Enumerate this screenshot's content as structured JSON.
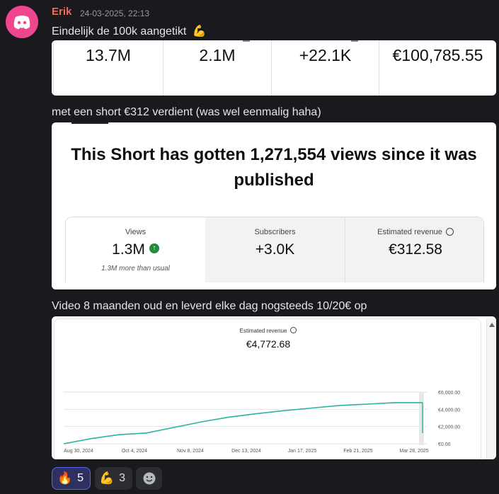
{
  "message": {
    "author": "Erik",
    "timestamp": "24-03-2025, 22:13",
    "line1": "Eindelijk de 100k aangetikt",
    "line2": "met een short €312 verdient (was wel eenmalig haha)",
    "line3": "Video 8 maanden oud en leverd elke dag nogsteeds 10/20€ op"
  },
  "metrics_strip": {
    "values": [
      "13.7M",
      "2.1M",
      "+22.1K",
      "€100,785.55"
    ]
  },
  "short_card": {
    "headline": "This Short has gotten 1,271,554 views since it was published",
    "stats": [
      {
        "label": "Views",
        "value": "1.3M",
        "sub": "1.3M more than usual"
      },
      {
        "label": "Subscribers",
        "value": "+3.0K"
      },
      {
        "label": "Estimated revenue",
        "value": "€312.58"
      }
    ]
  },
  "revenue_card": {
    "label": "Estimated revenue",
    "total": "€4,772.68"
  },
  "chart_data": {
    "type": "line",
    "x": [
      "Aug 30, 2024",
      "Sep 15, 2024",
      "Oct 4, 2024",
      "Oct 20, 2024",
      "Nov 8, 2024",
      "Nov 25, 2024",
      "Dec 13, 2024",
      "Dec 30, 2024",
      "Jan 17, 2025",
      "Feb 2, 2025",
      "Feb 21, 2025",
      "Mar 10, 2025",
      "Mar 24, 2025",
      "Mar 28, 2025"
    ],
    "values": [
      0,
      600,
      1050,
      1250,
      1900,
      2550,
      3100,
      3500,
      3850,
      4150,
      4450,
      4600,
      4772.68,
      4772.68
    ],
    "xticks": [
      "Aug 30, 2024",
      "Oct 4, 2024",
      "Nov 8, 2024",
      "Dec 13, 2024",
      "Jan 17, 2025",
      "Feb 21, 2025",
      "Mar 28, 2025"
    ],
    "yticks": [
      "€6,000.00",
      "€4,000.00",
      "€2,000.00",
      "€0.00"
    ],
    "ylim": [
      0,
      6000
    ],
    "color": "#2bb3a0",
    "grid": true
  },
  "reactions": [
    {
      "emoji": "🔥",
      "count": "5",
      "active": true
    },
    {
      "emoji": "💪",
      "count": "3",
      "active": false
    }
  ],
  "colors": {
    "background": "#1a1a1e",
    "author": "#f06b58",
    "accent": "#5865f2",
    "avatar": "#f0468e"
  }
}
